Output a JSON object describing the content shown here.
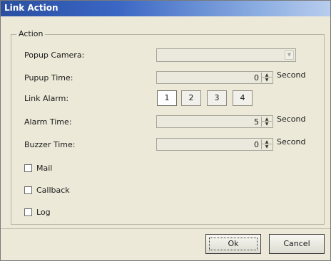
{
  "window": {
    "title": "Link Action"
  },
  "group": {
    "legend": "Action"
  },
  "fields": {
    "popup_camera": {
      "label": "Popup Camera:",
      "value": ""
    },
    "popup_time": {
      "label": "Pupup Time:",
      "value": "0",
      "unit": "Second"
    },
    "link_alarm": {
      "label": "Link Alarm:",
      "options": [
        "1",
        "2",
        "3",
        "4"
      ],
      "selected": "1"
    },
    "alarm_time": {
      "label": "Alarm Time:",
      "value": "5",
      "unit": "Second"
    },
    "buzzer_time": {
      "label": "Buzzer Time:",
      "value": "0",
      "unit": "Second"
    }
  },
  "checkboxes": {
    "mail": {
      "label": "Mail",
      "checked": false
    },
    "callback": {
      "label": "Callback",
      "checked": false
    },
    "log": {
      "label": "Log",
      "checked": false
    }
  },
  "buttons": {
    "ok": "Ok",
    "cancel": "Cancel"
  },
  "icons": {
    "dropdown": "chevron-down-icon",
    "spin_up": "spin-up-icon",
    "spin_down": "spin-down-icon"
  }
}
